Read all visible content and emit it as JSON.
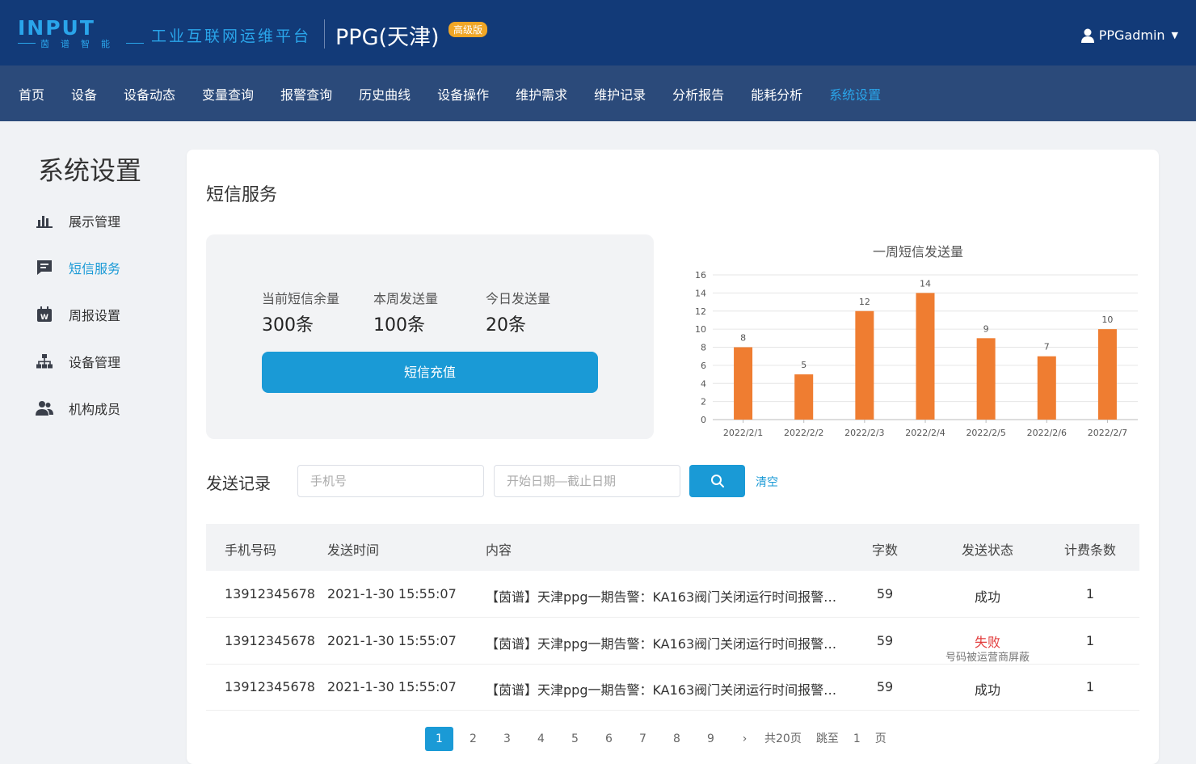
{
  "header": {
    "logo_text": "INPUT",
    "logo_sub": "茵谱智能",
    "platform": "工业互联网运维平台",
    "site": "PPG(天津)",
    "badge": "高级版",
    "user": "PPGadmin"
  },
  "nav": [
    "首页",
    "设备",
    "设备动态",
    "变量查询",
    "报警查询",
    "历史曲线",
    "设备操作",
    "维护需求",
    "维护记录",
    "分析报告",
    "能耗分析",
    "系统设置"
  ],
  "sidebar": {
    "title": "系统设置",
    "items": [
      {
        "label": "展示管理",
        "icon": "bar-chart-icon"
      },
      {
        "label": "短信服务",
        "icon": "message-icon"
      },
      {
        "label": "周报设置",
        "icon": "calendar-icon"
      },
      {
        "label": "设备管理",
        "icon": "org-tree-icon"
      },
      {
        "label": "机构成员",
        "icon": "members-icon"
      }
    ]
  },
  "main": {
    "title": "短信服务",
    "stats": [
      {
        "label": "当前短信余量",
        "value": "300条"
      },
      {
        "label": "本周发送量",
        "value": "100条"
      },
      {
        "label": "今日发送量",
        "value": "20条"
      }
    ],
    "recharge_label": "短信充值"
  },
  "chart_data": {
    "type": "bar",
    "title": "一周短信发送量",
    "categories": [
      "2022/2/1",
      "2022/2/2",
      "2022/2/3",
      "2022/2/4",
      "2022/2/5",
      "2022/2/6",
      "2022/2/7"
    ],
    "values": [
      8,
      5,
      12,
      14,
      9,
      7,
      10
    ],
    "ylim": [
      0,
      16
    ],
    "yticks": [
      0,
      2,
      4,
      6,
      8,
      10,
      12,
      14,
      16
    ],
    "color": "#ef7d31",
    "grid": true
  },
  "records": {
    "title": "发送记录",
    "phone_placeholder": "手机号",
    "date_placeholder": "开始日期—截止日期",
    "clear_label": "清空",
    "columns": [
      "手机号码",
      "发送时间",
      "内容",
      "字数",
      "发送状态",
      "计费条数"
    ],
    "rows": [
      {
        "phone": "13912345678",
        "time": "2021-1-30 15:55:07",
        "content": "【茵谱】天津ppg一期告警：KA163阀门关闭运行时间报警…",
        "chars": "59",
        "status": "成功",
        "note": "",
        "count": "1"
      },
      {
        "phone": "13912345678",
        "time": "2021-1-30 15:55:07",
        "content": "【茵谱】天津ppg一期告警：KA163阀门关闭运行时间报警…",
        "chars": "59",
        "status": "失败",
        "note": "号码被运营商屏蔽",
        "count": "1"
      },
      {
        "phone": "13912345678",
        "time": "2021-1-30 15:55:07",
        "content": "【茵谱】天津ppg一期告警：KA163阀门关闭运行时间报警…",
        "chars": "59",
        "status": "成功",
        "note": "",
        "count": "1"
      }
    ]
  },
  "pagination": {
    "pages": [
      "1",
      "2",
      "3",
      "4",
      "5",
      "6",
      "7",
      "8",
      "9"
    ],
    "next": "›",
    "total": "共20页",
    "jump_label": "跳至",
    "jump_value": "1",
    "page_suffix": "页"
  }
}
